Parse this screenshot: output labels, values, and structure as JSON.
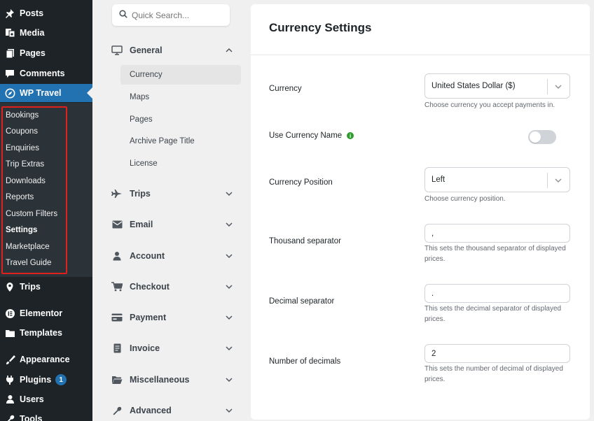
{
  "wp_menu": {
    "items": [
      {
        "label": "Posts",
        "icon": "pin-icon"
      },
      {
        "label": "Media",
        "icon": "media-icon"
      },
      {
        "label": "Pages",
        "icon": "pages-icon"
      },
      {
        "label": "Comments",
        "icon": "comments-icon"
      },
      {
        "label": "WP Travel",
        "icon": "compass-icon"
      },
      {
        "label": "Trips",
        "icon": "location-pin-icon"
      },
      {
        "label": "Elementor",
        "icon": "elementor-icon"
      },
      {
        "label": "Templates",
        "icon": "folder-icon"
      },
      {
        "label": "Appearance",
        "icon": "brush-icon"
      },
      {
        "label": "Plugins",
        "icon": "plug-icon",
        "badge": "1"
      },
      {
        "label": "Users",
        "icon": "user-icon"
      },
      {
        "label": "Tools",
        "icon": "wrench-icon"
      }
    ],
    "active": "WP Travel",
    "submenu": [
      "Bookings",
      "Coupons",
      "Enquiries",
      "Trip Extras",
      "Downloads",
      "Reports",
      "Custom Filters",
      "Settings",
      "Marketplace",
      "Travel Guide"
    ],
    "submenu_current": "Settings"
  },
  "settings_nav": {
    "search_placeholder": "Quick Search...",
    "general": {
      "label": "General",
      "expanded": true,
      "items": [
        "Currency",
        "Maps",
        "Pages",
        "Archive Page Title",
        "License"
      ],
      "active_item": "Currency"
    },
    "groups": [
      {
        "label": "Trips"
      },
      {
        "label": "Email"
      },
      {
        "label": "Account"
      },
      {
        "label": "Checkout"
      },
      {
        "label": "Payment"
      },
      {
        "label": "Invoice"
      },
      {
        "label": "Miscellaneous"
      },
      {
        "label": "Advanced"
      }
    ]
  },
  "panel": {
    "title": "Currency Settings",
    "currency": {
      "label": "Currency",
      "value": "United States Dollar ($)",
      "help": "Choose currency you accept payments in."
    },
    "use_currency_name": {
      "label": "Use Currency Name",
      "info": "i",
      "enabled": false
    },
    "currency_position": {
      "label": "Currency Position",
      "value": "Left",
      "help": "Choose currency position."
    },
    "thousand_separator": {
      "label": "Thousand separator",
      "value": ",",
      "help": "This sets the thousand separator of displayed prices."
    },
    "decimal_separator": {
      "label": "Decimal separator",
      "value": ".",
      "help": "This sets the decimal separator of displayed prices."
    },
    "number_of_decimals": {
      "label": "Number of decimals",
      "value": "2",
      "help": "This sets the number of decimal of displayed prices."
    }
  },
  "colors": {
    "wp_sidebar": "#1d2327",
    "wp_active": "#2271b1",
    "highlight_box": "#e0201c",
    "info_green": "#2e9b2e"
  }
}
